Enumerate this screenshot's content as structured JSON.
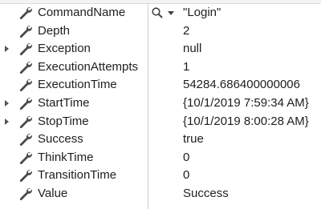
{
  "properties": [
    {
      "name": "CommandName",
      "value": "\"Login\"",
      "expandable": false,
      "has_search": true
    },
    {
      "name": "Depth",
      "value": "2",
      "expandable": false
    },
    {
      "name": "Exception",
      "value": "null",
      "expandable": true
    },
    {
      "name": "ExecutionAttempts",
      "value": "1",
      "expandable": false
    },
    {
      "name": "ExecutionTime",
      "value": "54284.686400000006",
      "expandable": false
    },
    {
      "name": "StartTime",
      "value": "{10/1/2019 7:59:34 AM}",
      "expandable": true
    },
    {
      "name": "StopTime",
      "value": "{10/1/2019 8:00:28 AM}",
      "expandable": true
    },
    {
      "name": "Success",
      "value": "true",
      "expandable": false
    },
    {
      "name": "ThinkTime",
      "value": "0",
      "expandable": false
    },
    {
      "name": "TransitionTime",
      "value": "0",
      "expandable": false
    },
    {
      "name": "Value",
      "value": "Success",
      "expandable": false
    }
  ],
  "icons": {
    "property": "wrench-icon",
    "expander": "expand-arrow-icon",
    "search": "search-icon",
    "dropdown": "dropdown-arrow-icon"
  },
  "colors": {
    "wrench": "#4a4a4a",
    "divider": "#cfcfcf",
    "text": "#1e1e1e"
  }
}
